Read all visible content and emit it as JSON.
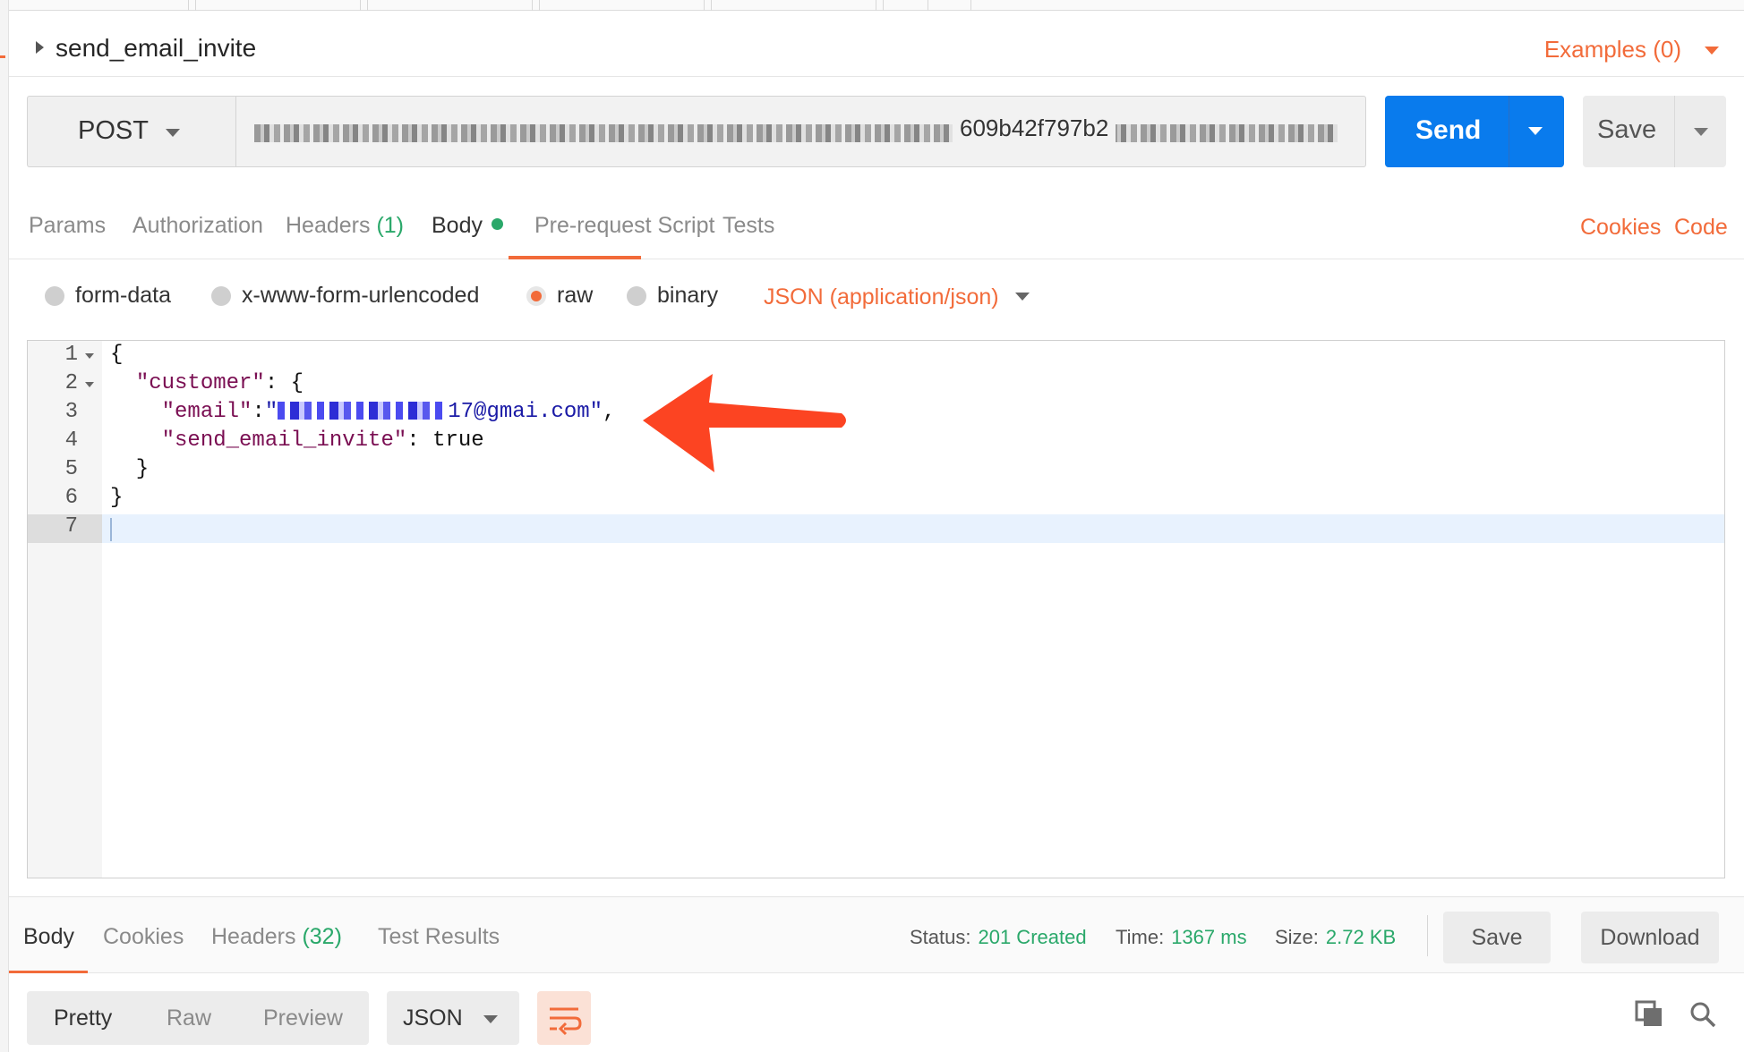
{
  "request": {
    "name": "send_email_invite",
    "examples_label": "Examples (0)",
    "method": "POST",
    "url_visible": "609b42f797b2",
    "send_label": "Send",
    "save_label": "Save"
  },
  "request_tabs": {
    "params": "Params",
    "authorization": "Authorization",
    "headers": "Headers",
    "headers_count": "(1)",
    "body": "Body",
    "pre_request": "Pre-request Script",
    "tests": "Tests",
    "cookies": "Cookies",
    "code": "Code"
  },
  "body_types": {
    "form_data": "form-data",
    "urlencoded": "x-www-form-urlencoded",
    "raw": "raw",
    "binary": "binary",
    "content_type": "JSON (application/json)"
  },
  "editor": {
    "line_numbers": [
      "1",
      "2",
      "3",
      "4",
      "5",
      "6",
      "7"
    ],
    "line1": "{",
    "key_customer": "\"customer\"",
    "line2_rest": ": {",
    "key_email": "\"email\"",
    "email_sep": ":",
    "email_open_quote": "\"",
    "email_value_visible": "17@gmai.com\"",
    "email_trailing": ",",
    "key_send_invite": "\"send_email_invite\"",
    "send_invite_sep": ": ",
    "send_invite_value": "true",
    "line5": "  }",
    "line6": "}"
  },
  "response": {
    "tabs": {
      "body": "Body",
      "cookies": "Cookies",
      "headers": "Headers",
      "headers_count": "(32)",
      "test_results": "Test Results"
    },
    "status_label": "Status:",
    "status_value": "201 Created",
    "time_label": "Time:",
    "time_value": "1367 ms",
    "size_label": "Size:",
    "size_value": "2.72 KB",
    "save_label": "Save",
    "download_label": "Download",
    "views": {
      "pretty": "Pretty",
      "raw": "Raw",
      "preview": "Preview"
    },
    "format": "JSON"
  },
  "colors": {
    "accent": "#f26b3a",
    "send_blue": "#097bed",
    "success_green": "#2aa86a",
    "annotation_arrow": "#fc4422"
  }
}
